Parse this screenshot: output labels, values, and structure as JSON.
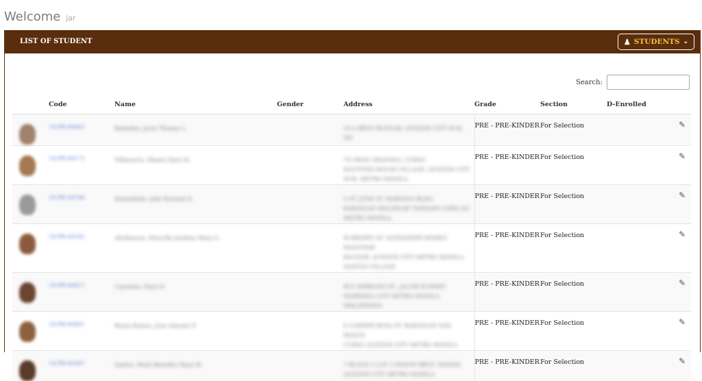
{
  "header": {
    "welcome": "Welcome",
    "user": "jar"
  },
  "panel": {
    "title": "LIST OF STUDENT",
    "students_button": "STUDENTS"
  },
  "search": {
    "label": "Search:",
    "value": ""
  },
  "table": {
    "headers": [
      "Code",
      "Name",
      "Gender",
      "Address",
      "Grade",
      "Section",
      "D-Enrolled"
    ],
    "rows": [
      {
        "code": "14-PR-00063",
        "name": "Balandra, Jovie Thomas L.",
        "address": "16-A BRGY BUNGAD, QUEZON CITY M.M.",
        "address2": "ND",
        "grade": "PRE - PRE-KINDER",
        "section": "For Selection",
        "avatar": "#a0826d"
      },
      {
        "code": "14-PR-00173",
        "name": "Villanueva, Shawn Dave M.",
        "address": "79 GRAN GRANADA, CUBAO",
        "address2": "HAUNTED HOUSE VILLAGE, QUEZON CITY",
        "address3": "NCR, METRO MANILA",
        "grade": "PRE - PRE-KINDER",
        "section": "For Selection",
        "avatar": "#a47850"
      },
      {
        "code": "14-PR-00196",
        "name": "Dexterbeth, John Richard D.",
        "address": "5 ST. JUDE ST. MARIANA BLDG.",
        "address2": "BARANGAY MALINGAP TANDANG SORA QC",
        "address3": "METRO MANILA",
        "grade": "PRE - PRE-KINDER",
        "section": "For Selection",
        "avatar": "#9a9a9a"
      },
      {
        "code": "14-PR-00182",
        "name": "Abellanosa, Prescilla Jorahna Mary G.",
        "address": "M BROWN ST. ALEXANDER HOMES MAGUYAM",
        "address2": "BACOOR, QUEZON CITY METRO MANILA",
        "address3": "SANTOS VILLAGE",
        "grade": "PRE - PRE-KINDER",
        "section": "For Selection",
        "avatar": "#8b5a3c"
      },
      {
        "code": "14-PR-00411",
        "name": "Cayetano, Kaye D.",
        "address": "#25 SERRANO ST., JACOB SUMMIT",
        "address2": "MARIKINA CITY METRO MANILA",
        "address3": "PHILIPPINES",
        "grade": "PRE - PRE-KINDER",
        "section": "For Selection",
        "avatar": "#6b4530"
      },
      {
        "code": "14-PR-00401",
        "name": "Reyes-Ramos, Jose Antonio P.",
        "address": "8 CORNER ROSA ST. BARANGAY SAN ROQUE",
        "address2": "CUBAO QUEZON CITY METRO MANILA",
        "grade": "PRE - PRE-KINDER",
        "section": "For Selection",
        "avatar": "#8e6040"
      },
      {
        "code": "14-PR-00387",
        "name": "Santos, Mark Benedict Ryan M.",
        "address": "7 BLOCK 2 LOT 3 MAYON BRGY. PANSOL",
        "address2": "QUEZON CITY METRO MANILA",
        "grade": "PRE - PRE-KINDER",
        "section": "For Selection",
        "avatar": "#5a3a28"
      }
    ]
  }
}
